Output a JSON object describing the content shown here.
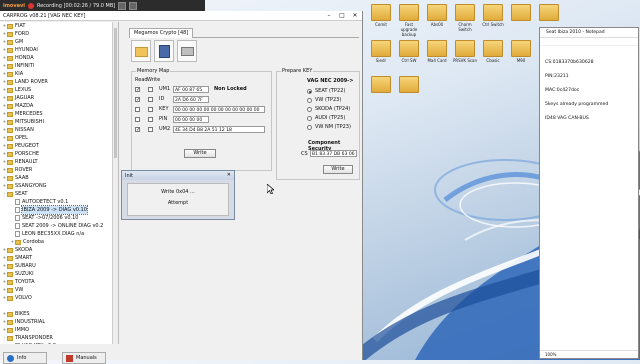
{
  "recorder": {
    "logo": "imovavi",
    "status": "Recording  [00:02:26 / 79.0 MB]"
  },
  "app": {
    "title": "CARPROG   v08.21  [VAG NEC KEY]",
    "tree": [
      {
        "label": "FIAT",
        "depth": 0,
        "type": "folder",
        "toggle": "+"
      },
      {
        "label": "FORD",
        "depth": 0,
        "type": "folder",
        "toggle": "+"
      },
      {
        "label": "GM",
        "depth": 0,
        "type": "folder",
        "toggle": "+"
      },
      {
        "label": "HYUNDAI",
        "depth": 0,
        "type": "folder",
        "toggle": "+"
      },
      {
        "label": "HONDA",
        "depth": 0,
        "type": "folder",
        "toggle": "+"
      },
      {
        "label": "INFINITI",
        "depth": 0,
        "type": "folder",
        "toggle": "+"
      },
      {
        "label": "KIA",
        "depth": 0,
        "type": "folder",
        "toggle": "+"
      },
      {
        "label": "LAND ROVER",
        "depth": 0,
        "type": "folder",
        "toggle": "+"
      },
      {
        "label": "LEXUS",
        "depth": 0,
        "type": "folder",
        "toggle": "+"
      },
      {
        "label": "JAGUAR",
        "depth": 0,
        "type": "folder",
        "toggle": "+"
      },
      {
        "label": "MAZDA",
        "depth": 0,
        "type": "folder",
        "toggle": "+"
      },
      {
        "label": "MERCEDES",
        "depth": 0,
        "type": "folder",
        "toggle": "+"
      },
      {
        "label": "MITSUBISHI",
        "depth": 0,
        "type": "folder",
        "toggle": "+"
      },
      {
        "label": "NISSAN",
        "depth": 0,
        "type": "folder",
        "toggle": "+"
      },
      {
        "label": "OPEL",
        "depth": 0,
        "type": "folder",
        "toggle": "+"
      },
      {
        "label": "PEUGEOT",
        "depth": 0,
        "type": "folder",
        "toggle": "+"
      },
      {
        "label": "PORSCHE",
        "depth": 0,
        "type": "folder",
        "toggle": "+"
      },
      {
        "label": "RENAULT",
        "depth": 0,
        "type": "folder",
        "toggle": "+"
      },
      {
        "label": "ROVER",
        "depth": 0,
        "type": "folder",
        "toggle": "+"
      },
      {
        "label": "SAAB",
        "depth": 0,
        "type": "folder",
        "toggle": "+"
      },
      {
        "label": "SSANGYONG",
        "depth": 0,
        "type": "folder",
        "toggle": "+"
      },
      {
        "label": "SEAT",
        "depth": 0,
        "type": "folder",
        "toggle": "-"
      },
      {
        "label": "AUTODETECT v0.1",
        "depth": 1,
        "type": "page",
        "toggle": ""
      },
      {
        "label": "IBIZA 2009 -> DIAG v0.10",
        "depth": 1,
        "type": "page",
        "toggle": "",
        "selected": true
      },
      {
        "label": "SEAT ->07/2006 v0.10",
        "depth": 1,
        "type": "page",
        "toggle": ""
      },
      {
        "label": "SEAT 2009 -> ONLINE DIAG v0.2",
        "depth": 1,
        "type": "page",
        "toggle": ""
      },
      {
        "label": "LEON BEC35XX DIAG n/a",
        "depth": 1,
        "type": "page",
        "toggle": ""
      },
      {
        "label": "Cordoba",
        "depth": 1,
        "type": "folder",
        "toggle": "+"
      },
      {
        "label": "SKODA",
        "depth": 0,
        "type": "folder",
        "toggle": "+"
      },
      {
        "label": "SMART",
        "depth": 0,
        "type": "folder",
        "toggle": "+"
      },
      {
        "label": "SUBARU",
        "depth": 0,
        "type": "folder",
        "toggle": "+"
      },
      {
        "label": "SUZUKI",
        "depth": 0,
        "type": "folder",
        "toggle": "+"
      },
      {
        "label": "TOYOTA",
        "depth": 0,
        "type": "folder",
        "toggle": "+"
      },
      {
        "label": "VW",
        "depth": 0,
        "type": "folder",
        "toggle": "+"
      },
      {
        "label": "VOLVO",
        "depth": 0,
        "type": "folder",
        "toggle": "+"
      },
      {
        "label": "",
        "depth": 0,
        "type": "gap",
        "toggle": ""
      },
      {
        "label": "BIKES",
        "depth": 0,
        "type": "folder",
        "toggle": "+"
      },
      {
        "label": "INDUSTRIAL",
        "depth": 0,
        "type": "folder",
        "toggle": "+"
      },
      {
        "label": "IMMO",
        "depth": 0,
        "type": "folder",
        "toggle": "+"
      },
      {
        "label": "TRANSPONDER",
        "depth": 0,
        "type": "folder",
        "toggle": "-"
      },
      {
        "label": "VAG KEY v0.8",
        "depth": 1,
        "type": "page",
        "toggle": ""
      },
      {
        "label": "VAG NEC KEY v0.1",
        "depth": 1,
        "type": "page",
        "toggle": ""
      },
      {
        "label": "VOLVO KEY v0.1",
        "depth": 1,
        "type": "page",
        "toggle": ""
      }
    ],
    "bottom": {
      "info": "Info",
      "manuals": "Manuals"
    },
    "module": {
      "tab": "Megamos Crypto [48]",
      "memory_map": {
        "title": "Memory Map",
        "read_col": "Read",
        "write_col": "Write",
        "rows": [
          {
            "label": "UM1",
            "read": true,
            "write": false,
            "value": "AF 00 87 65",
            "note": "Non Locked"
          },
          {
            "label": "ID",
            "read": true,
            "write": false,
            "value": "2A D6 60 7F",
            "note": ""
          },
          {
            "label": "KEY",
            "read": false,
            "write": false,
            "value": "00 00 00 00 00 00 00 00 00 00 00 00",
            "note": ""
          },
          {
            "label": "PIN",
            "read": false,
            "write": false,
            "value": "00 00 00 00",
            "note": ""
          },
          {
            "label": "UM2",
            "read": true,
            "write": false,
            "value": "4E 34 D4 B8 2A 51 12 18",
            "note": ""
          }
        ],
        "write_btn": "Write"
      },
      "prepare": {
        "title": "Prepare KEY",
        "heading": "VAG NEC 2009->",
        "options": [
          {
            "label": "SEAT (TP22)",
            "checked": true
          },
          {
            "label": "VW (TP23)",
            "checked": false
          },
          {
            "label": "SKODA (TP24)",
            "checked": false
          },
          {
            "label": "AUDI (TP25)",
            "checked": false
          },
          {
            "label": "VW NM (TP23)",
            "checked": false
          }
        ],
        "security_title": "Component Security",
        "cs_label": "CS",
        "cs_value": "B1 83 37 DB 63 06 28",
        "write_btn": "Write"
      }
    },
    "dialog": {
      "title": "Init",
      "line1": "Write 0x04 ...",
      "line2": "Attempt"
    }
  },
  "desktop": {
    "icons": [
      {
        "label": "Comit",
        "kind": "folder"
      },
      {
        "label": "Fast upgrade backup",
        "kind": "folder"
      },
      {
        "label": "Abs00",
        "kind": "folder"
      },
      {
        "label": "Charm Switch",
        "kind": "folder"
      },
      {
        "label": "Ctrl Switch",
        "kind": "folder"
      },
      {
        "label": "",
        "kind": "folder"
      },
      {
        "label": "",
        "kind": "folder"
      },
      {
        "label": "Siedr",
        "kind": "folder"
      },
      {
        "label": "Ctrl SW",
        "kind": "folder"
      },
      {
        "label": "Ma4 Card",
        "kind": "folder"
      },
      {
        "label": "PRSVK Scan",
        "kind": "folder"
      },
      {
        "label": "Cbasic",
        "kind": "folder"
      },
      {
        "label": "M90",
        "kind": "folder"
      },
      {
        "label": "PBO Scan",
        "kind": "folder"
      },
      {
        "label": "",
        "kind": "folder"
      },
      {
        "label": "",
        "kind": "folder"
      }
    ]
  },
  "notepad": {
    "title": "Seat Ibiza 2010 - Notepad",
    "lines": [
      "CS:0183370b630628",
      "PIN:23211",
      "MAC:0c427doc",
      "5keys already programmed",
      "ID48 VAG CAN-BUS"
    ],
    "zoom": "100%"
  }
}
